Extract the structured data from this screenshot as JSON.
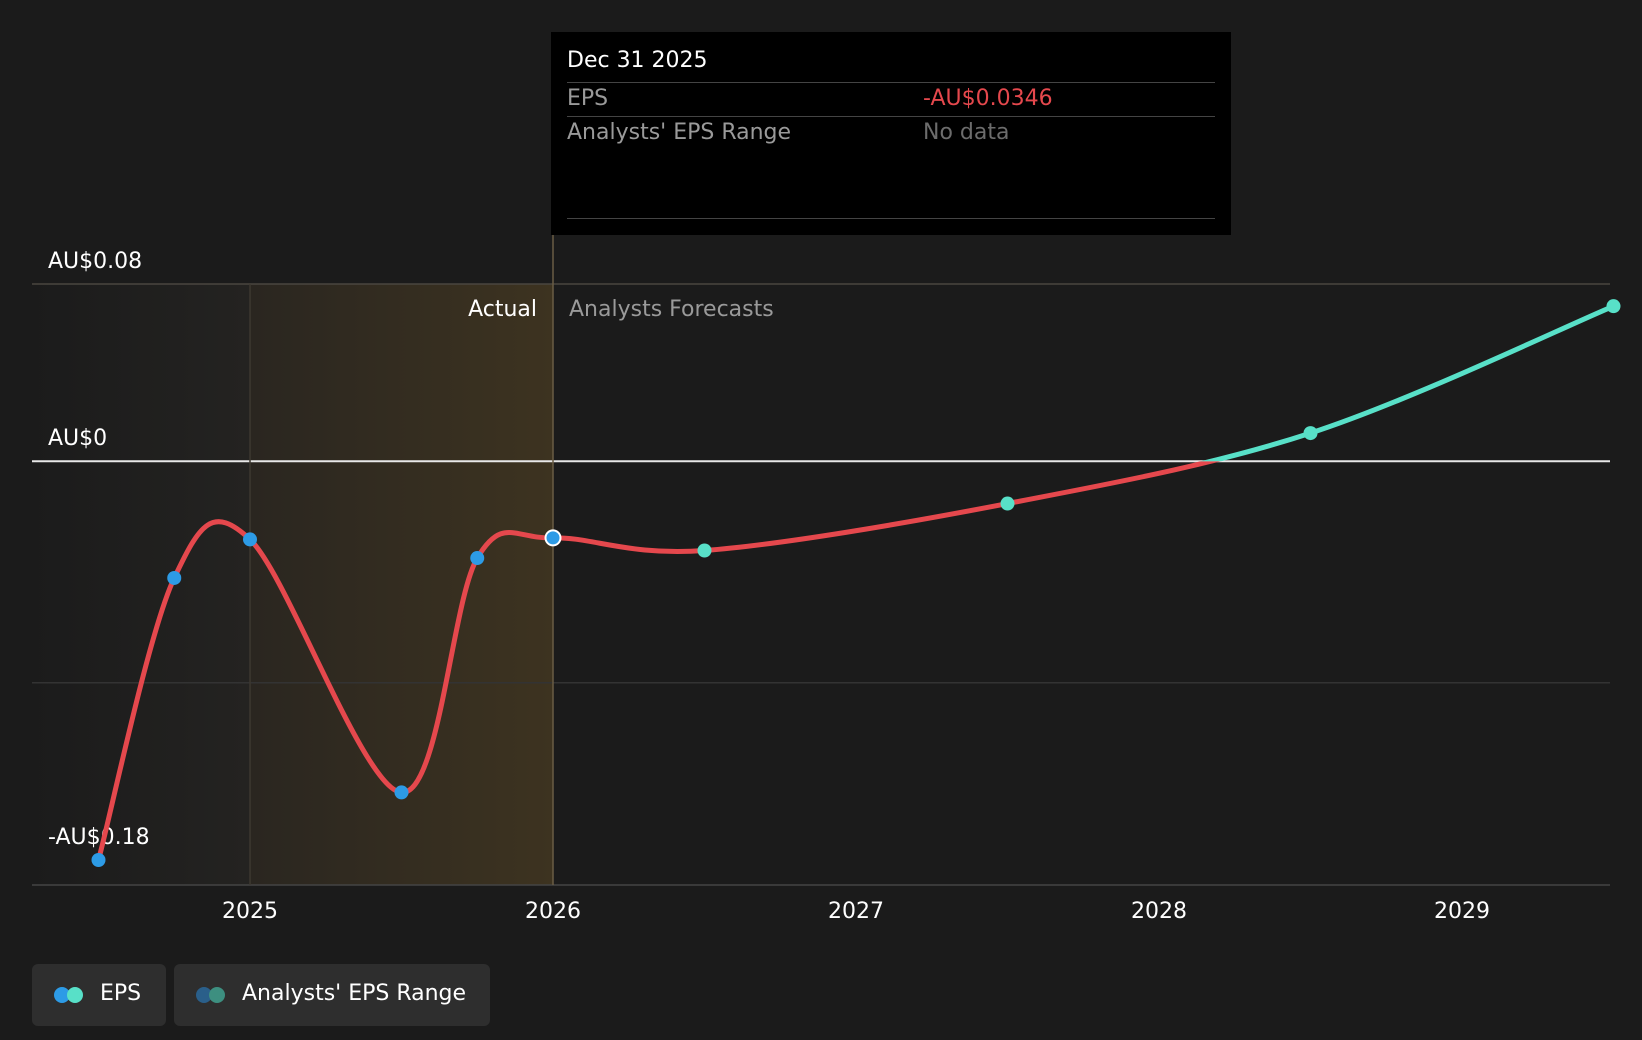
{
  "chart_data": {
    "type": "line",
    "y_axis": {
      "tick_labels": [
        "AU$0.08",
        "AU$0",
        "-AU$0.18"
      ],
      "ylim": [
        -0.18,
        0.08
      ]
    },
    "x_axis": {
      "tick_labels": [
        "2025",
        "2026",
        "2027",
        "2028",
        "2029"
      ],
      "xlim": [
        2024.3,
        2029.5
      ]
    },
    "region_labels": {
      "actual": "Actual",
      "forecast": "Analysts Forecasts"
    },
    "actual_forecast_split": 2026.0,
    "series": [
      {
        "name": "EPS",
        "actual_points": [
          {
            "x": 2024.5,
            "y": -0.18
          },
          {
            "x": 2024.75,
            "y": -0.0527
          },
          {
            "x": 2025.0,
            "y": -0.0353
          },
          {
            "x": 2025.5,
            "y": -0.1495
          },
          {
            "x": 2025.75,
            "y": -0.0437
          },
          {
            "x": 2026.0,
            "y": -0.0346
          }
        ],
        "forecast_points": [
          {
            "x": 2026.5,
            "y": -0.0403
          },
          {
            "x": 2027.5,
            "y": -0.0191
          },
          {
            "x": 2028.5,
            "y": 0.0127
          },
          {
            "x": 2029.5,
            "y": 0.07
          }
        ]
      }
    ],
    "colors": {
      "negative_line": "#e5484d",
      "positive_line": "#58e0c8",
      "actual_marker": "#2d9be6",
      "forecast_marker": "#58e0c8",
      "negative_value_text": "#e5484d"
    }
  },
  "tooltip": {
    "date": "Dec 31 2025",
    "rows": [
      {
        "label": "EPS",
        "value": "-AU$0.0346"
      },
      {
        "label": "Analysts' EPS Range",
        "value": "No data"
      }
    ]
  },
  "legend": {
    "items": [
      {
        "label": "EPS"
      },
      {
        "label": "Analysts' EPS Range"
      }
    ]
  }
}
